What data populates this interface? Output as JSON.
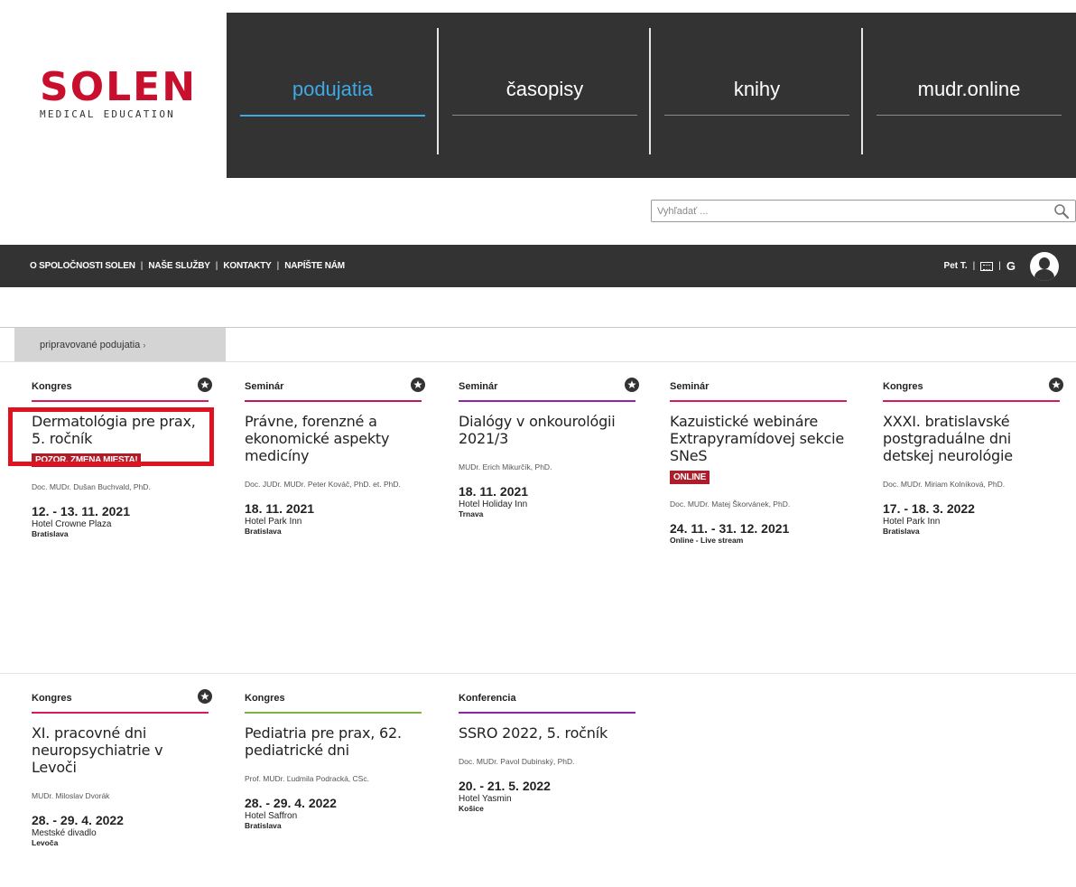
{
  "logo": {
    "main": "SOLEN",
    "sub": "MEDICAL EDUCATION"
  },
  "topnav": [
    {
      "label": "podujatia",
      "active": true
    },
    {
      "label": "časopisy",
      "active": false
    },
    {
      "label": "knihy",
      "active": false
    },
    {
      "label": "mudr.online",
      "active": false
    }
  ],
  "search": {
    "placeholder": "Vyhľadať ...",
    "icon": "search-icon"
  },
  "secnav": {
    "items": [
      "O SPOLOČNOSTI SOLEN",
      "NAŠE SLUŽBY",
      "KONTAKTY",
      "NAPÍŠTE NÁM"
    ],
    "separator": "|"
  },
  "user": {
    "name": "Pet T.",
    "separator": "|",
    "google_glyph": "G"
  },
  "tab": {
    "label": "pripravované podujatia",
    "chevron": "›"
  },
  "colors": {
    "dark": "#333333",
    "accent_blue": "#3fa9e5",
    "brand_red": "#c8102e",
    "badge_red": "#b01d2a",
    "pink": "#c2185b",
    "purple": "#8e44ad",
    "green": "#7cb342"
  },
  "events": [
    {
      "type": "Kongres",
      "line_color": "#d81b60",
      "title": "Dermatológia pre prax, 5. ročník",
      "badge": "POZOR, ZMENA MIESTA!",
      "author": "Doc. MUDr. Dušan Buchvald, PhD.",
      "date": "12. - 13. 11. 2021",
      "venue": "Hotel Crowne Plaza",
      "city": "Bratislava",
      "starred": true
    },
    {
      "type": "Seminár",
      "line_color": "#c2185b",
      "title": "Právne, forenzné a ekonomické aspekty medicíny",
      "badge": "",
      "author": "Doc. JUDr. MUDr. Peter Kováč, PhD. et. PhD.",
      "date": "18. 11. 2021",
      "venue": "Hotel Park Inn",
      "city": "Bratislava",
      "starred": true
    },
    {
      "type": "Seminár",
      "line_color": "#8e24aa",
      "title": "Dialógy v onkourológii 2021/3",
      "badge": "",
      "author": "MUDr. Erich Mikurčík, PhD.",
      "date": "18. 11. 2021",
      "venue": "Hotel Holiday Inn",
      "city": "Trnava",
      "starred": true
    },
    {
      "type": "Seminár",
      "line_color": "#d81b60",
      "title": "Kazuistické webináre Extrapyramídovej sekcie SNeS",
      "badge": "ONLINE",
      "author": "Doc. MUDr. Matej Škorvánek, PhD.",
      "date": "24. 11. - 31. 12. 2021",
      "venue": "Online - Live stream",
      "city": "",
      "starred": false
    },
    {
      "type": "Kongres",
      "line_color": "#d81b60",
      "title": "XXXI. bratislavské postgraduálne dni detskej neurológie",
      "badge": "",
      "author": "Doc. MUDr. Miriam Kolníková, PhD.",
      "date": "17. - 18. 3. 2022",
      "venue": "Hotel Park Inn",
      "city": "Bratislava",
      "starred": true
    },
    {
      "type": "Kongres",
      "line_color": "#d81b60",
      "title": "XI. pracovné dni neuropsychiatrie v Levoči",
      "badge": "",
      "author": "MUDr. Miloslav Dvorák",
      "date": "28. - 29. 4. 2022",
      "venue": "Mestské divadlo",
      "city": "Levoča",
      "starred": true
    },
    {
      "type": "Kongres",
      "line_color": "#7cb342",
      "title": "Pediatria pre prax, 62. pediatrické dni",
      "badge": "",
      "author": "Prof. MUDr. Ľudmila Podracká, CSc.",
      "date": "28. - 29. 4. 2022",
      "venue": "Hotel Saffron",
      "city": "Bratislava",
      "starred": false
    },
    {
      "type": "Konferencia",
      "line_color": "#8e24aa",
      "title": "SSRO 2022, 5. ročník",
      "badge": "",
      "author": "Doc. MUDr. Pavol Dubinský, PhD.",
      "date": "20. - 21. 5. 2022",
      "venue": "Hotel Yasmin",
      "city": "Košice",
      "starred": false
    }
  ]
}
